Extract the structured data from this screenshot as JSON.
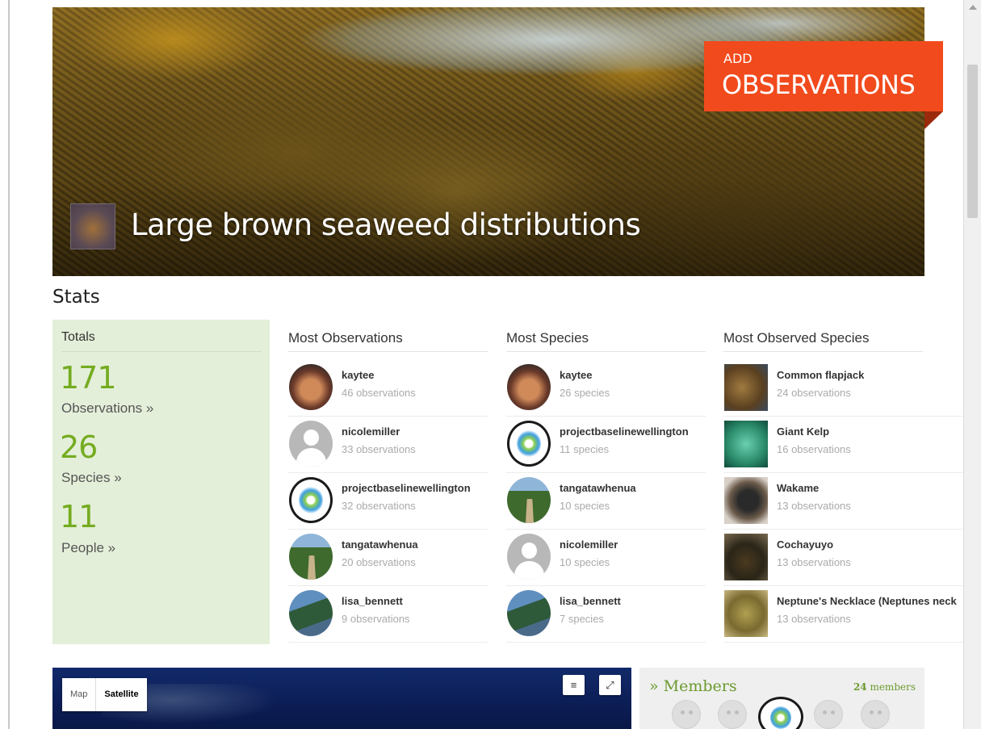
{
  "hero": {
    "title": "Large brown seaweed distributions",
    "add_button": {
      "small": "ADD",
      "big": "OBSERVATIONS",
      "color": "#f14a1d"
    }
  },
  "stats": {
    "heading": "Stats",
    "totals": {
      "heading": "Totals",
      "observations": {
        "value": "171",
        "label": "Observations »"
      },
      "species": {
        "value": "26",
        "label": "Species »"
      },
      "people": {
        "value": "11",
        "label": "People »"
      }
    },
    "most_observations": {
      "heading": "Most Observations",
      "rows": [
        {
          "name": "kaytee",
          "sub": "46 observations"
        },
        {
          "name": "nicolemiller",
          "sub": "33 observations"
        },
        {
          "name": "projectbaselinewellington",
          "sub": "32 observations"
        },
        {
          "name": "tangatawhenua",
          "sub": "20 observations"
        },
        {
          "name": "lisa_bennett",
          "sub": "9 observations"
        }
      ]
    },
    "most_species": {
      "heading": "Most Species",
      "rows": [
        {
          "name": "kaytee",
          "sub": "26 species"
        },
        {
          "name": "projectbaselinewellington",
          "sub": "11 species"
        },
        {
          "name": "tangatawhenua",
          "sub": "10 species"
        },
        {
          "name": "nicolemiller",
          "sub": "10 species"
        },
        {
          "name": "lisa_bennett",
          "sub": "7 species"
        }
      ]
    },
    "most_observed_species": {
      "heading": "Most Observed Species",
      "rows": [
        {
          "name": "Common flapjack",
          "sub": "24 observations"
        },
        {
          "name": "Giant Kelp",
          "sub": "16 observations"
        },
        {
          "name": "Wakame",
          "sub": "13 observations"
        },
        {
          "name": "Cochayuyo",
          "sub": "13 observations"
        },
        {
          "name": "Neptune's Necklace (Neptunes neck",
          "sub": "13 observations"
        }
      ]
    }
  },
  "map": {
    "type_options": [
      "Map",
      "Satellite"
    ],
    "selected": "Satellite",
    "layers_icon": "layers-icon",
    "fullscreen_icon": "fullscreen-icon"
  },
  "members": {
    "title": "» Members",
    "count_number": "24",
    "count_label": " members"
  },
  "colors": {
    "accent_green": "#74ac20",
    "totals_bg": "#e4efd9"
  }
}
